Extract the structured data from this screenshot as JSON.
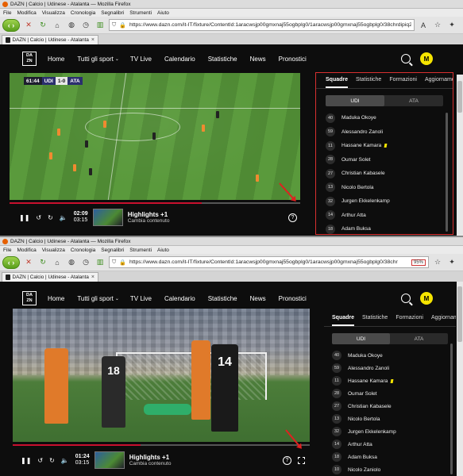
{
  "top": {
    "window_title": "DAZN | Calcio | Udinese - Atalanta — Mozilla Firefox",
    "menu": [
      "File",
      "Modifica",
      "Visualizza",
      "Cronologia",
      "Segnalibri",
      "Strumenti",
      "Aiuto"
    ],
    "url": "https://www.dazn.com/it-IT/fixture/ContentId:1aracwsjp00gmxnaj55ogbplg0/1aracwsjp00gmxnaj55ogbplg0/38chrdipiq2v",
    "tab_title": "DAZN | Calcio | Udinese - Atalanta",
    "nav": [
      "Home",
      "Tutti gli sport",
      "TV Live",
      "Calendario",
      "Statistiche",
      "News",
      "Pronostici"
    ],
    "avatar_initial": "M",
    "scorebug": {
      "clock": "61:44",
      "home": "UDI",
      "score": "1-0",
      "away": "ATA"
    },
    "time_current": "02:09",
    "time_total": "03:15",
    "progress": 0.66,
    "highlight_title": "Highlights +1",
    "highlight_sub": "Cambia contenuto",
    "help_label": "?",
    "panel_tabs": [
      "Squadre",
      "Statistiche",
      "Formazioni",
      "Aggiornamenti li"
    ],
    "team_toggle": [
      "UDI",
      "ATA"
    ],
    "roster": [
      {
        "num": "40",
        "name": "Maduka Okoye",
        "yellow": false
      },
      {
        "num": "59",
        "name": "Alessandro Zanoli",
        "yellow": false
      },
      {
        "num": "11",
        "name": "Hassane Kamara",
        "yellow": true
      },
      {
        "num": "28",
        "name": "Oumar Solet",
        "yellow": false
      },
      {
        "num": "27",
        "name": "Christian Kabasele",
        "yellow": false
      },
      {
        "num": "13",
        "name": "Nicolo Bertola",
        "yellow": false
      },
      {
        "num": "32",
        "name": "Jurgen Ekkelenkamp",
        "yellow": false
      },
      {
        "num": "14",
        "name": "Arthur Atta",
        "yellow": false
      },
      {
        "num": "18",
        "name": "Adam Buksa",
        "yellow": false
      }
    ]
  },
  "bottom": {
    "window_title": "DAZN | Calcio | Udinese - Atalanta — Mozilla Firefox",
    "menu": [
      "File",
      "Modifica",
      "Visualizza",
      "Cronologia",
      "Segnalibri",
      "Strumenti",
      "Aiuto"
    ],
    "url": "https://www.dazn.com/it-IT/fixture/ContentId:1aracwsjp00gmxnaj55ogbplg0/1aracwsjp00gmxnaj55ogbplg0/38chr",
    "zoom": "95%",
    "tab_title": "DAZN | Calcio | Udinese - Atalanta",
    "nav": [
      "Home",
      "Tutti gli sport",
      "TV Live",
      "Calendario",
      "Statistiche",
      "News",
      "Pronostici"
    ],
    "avatar_initial": "M",
    "jersey_numbers": [
      "18",
      "14"
    ],
    "time_current": "01:24",
    "time_total": "03:15",
    "progress": 0.43,
    "highlight_title": "Highlights +1",
    "highlight_sub": "Cambia contenuto",
    "help_label": "?",
    "panel_tabs": [
      "Squadre",
      "Statistiche",
      "Formazioni",
      "Aggiornamenti live"
    ],
    "team_toggle": [
      "UDI",
      "ATA"
    ],
    "roster": [
      {
        "num": "40",
        "name": "Maduka Okoye",
        "yellow": false
      },
      {
        "num": "59",
        "name": "Alessandro Zanoli",
        "yellow": false
      },
      {
        "num": "11",
        "name": "Hassane Kamara",
        "yellow": true
      },
      {
        "num": "28",
        "name": "Oumar Solet",
        "yellow": false
      },
      {
        "num": "27",
        "name": "Christian Kabasele",
        "yellow": false
      },
      {
        "num": "13",
        "name": "Nicolo Bertola",
        "yellow": false
      },
      {
        "num": "32",
        "name": "Jurgen Ekkelenkamp",
        "yellow": false
      },
      {
        "num": "14",
        "name": "Arthur Atta",
        "yellow": false
      },
      {
        "num": "18",
        "name": "Adam Buksa",
        "yellow": false
      },
      {
        "num": "10",
        "name": "Nicolo Zaniolo",
        "yellow": false
      }
    ]
  },
  "colors": {
    "accent_red": "#c8102e",
    "dazn_yellow": "#f5e400",
    "annotation_red": "#e02020"
  }
}
